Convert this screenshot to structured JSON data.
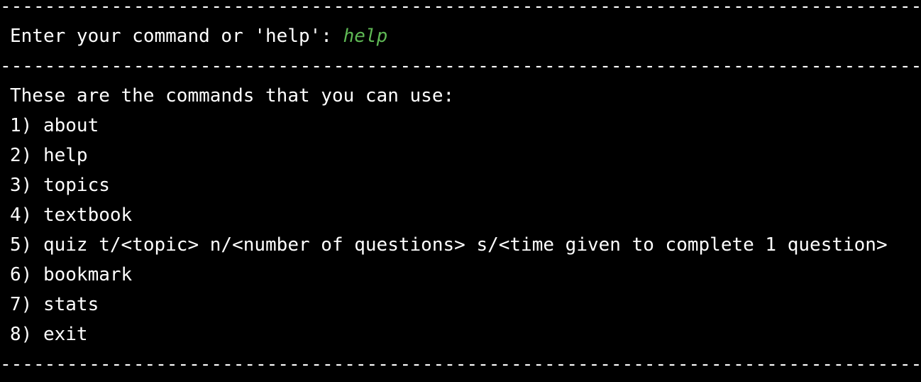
{
  "terminal": {
    "divider_text": "------------------------------------------------------------------------------------------------------",
    "prompt": "Enter your command or 'help': ",
    "user_input": "help",
    "header": "These are the commands that you can use:",
    "commands": [
      "1) about",
      "2) help",
      "3) topics",
      "4) textbook",
      "5) quiz t/<topic> n/<number of questions> s/<time given to complete 1 question>",
      "6) bookmark",
      "7) stats",
      "8) exit"
    ],
    "colors": {
      "background": "#000000",
      "text": "#ffffff",
      "user_input": "#5fb955"
    }
  }
}
